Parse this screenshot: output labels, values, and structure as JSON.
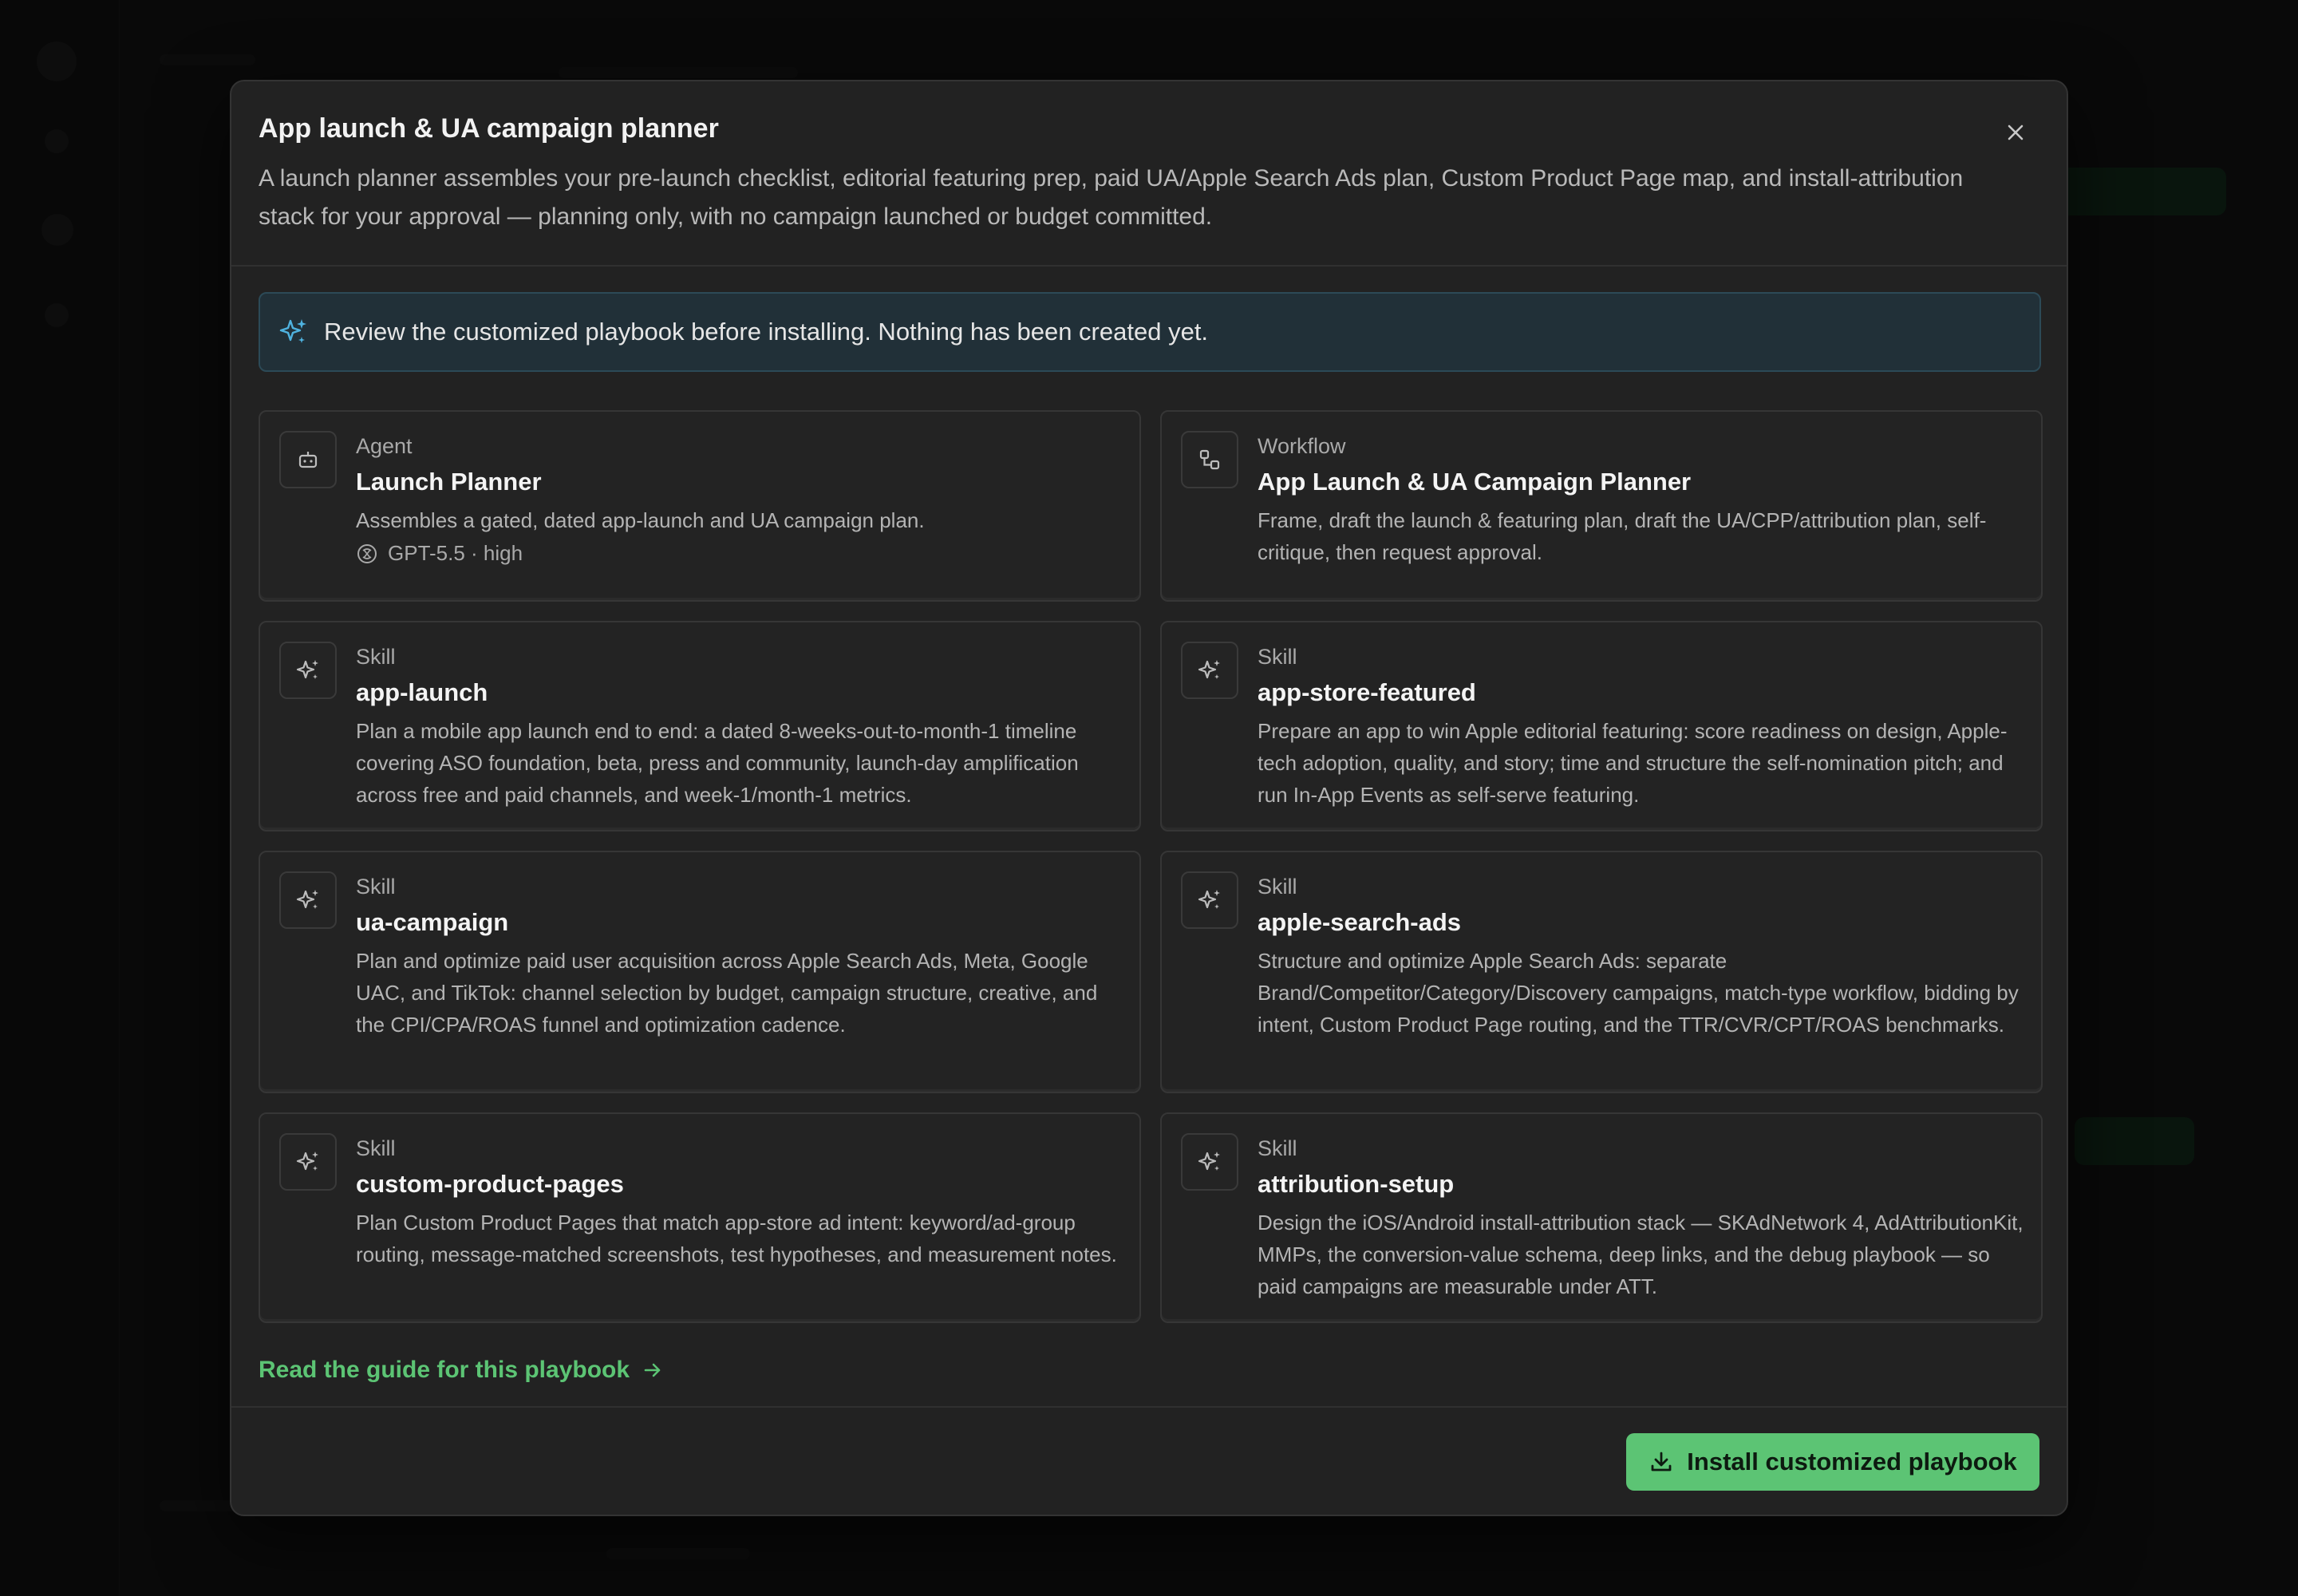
{
  "modal": {
    "title": "App launch & UA campaign planner",
    "description": "A launch planner assembles your pre-launch checklist, editorial featuring prep, paid UA/Apple Search Ads plan, Custom Product Page map, and install-attribution stack for your approval — planning only, with no campaign launched or budget committed."
  },
  "notice": {
    "text": "Review the customized playbook before installing. Nothing has been created yet."
  },
  "cards": [
    {
      "type": "Agent",
      "name": "Launch Planner",
      "description": "Assembles a gated, dated app-launch and UA campaign plan.",
      "model": "GPT-5.5 · high",
      "icon": "robot-icon"
    },
    {
      "type": "Workflow",
      "name": "App Launch & UA Campaign Planner",
      "description": "Frame, draft the launch & featuring plan, draft the UA/CPP/attribution plan, self-critique, then request approval.",
      "icon": "workflow-icon"
    },
    {
      "type": "Skill",
      "name": "app-launch",
      "description": "Plan a mobile app launch end to end: a dated 8-weeks-out-to-month-1 timeline covering ASO foundation, beta, press and community, launch-day amplification across free and paid channels, and week-1/month-1 metrics.",
      "icon": "sparkle-icon"
    },
    {
      "type": "Skill",
      "name": "app-store-featured",
      "description": "Prepare an app to win Apple editorial featuring: score readiness on design, Apple-tech adoption, quality, and story; time and structure the self-nomination pitch; and run In-App Events as self-serve featuring.",
      "icon": "sparkle-icon"
    },
    {
      "type": "Skill",
      "name": "ua-campaign",
      "description": "Plan and optimize paid user acquisition across Apple Search Ads, Meta, Google UAC, and TikTok: channel selection by budget, campaign structure, creative, and the CPI/CPA/ROAS funnel and optimization cadence.",
      "icon": "sparkle-icon"
    },
    {
      "type": "Skill",
      "name": "apple-search-ads",
      "description": "Structure and optimize Apple Search Ads: separate Brand/Competitor/Category/Discovery campaigns, match-type workflow, bidding by intent, Custom Product Page routing, and the TTR/CVR/CPT/ROAS benchmarks.",
      "icon": "sparkle-icon"
    },
    {
      "type": "Skill",
      "name": "custom-product-pages",
      "description": "Plan Custom Product Pages that match app-store ad intent: keyword/ad-group routing, message-matched screenshots, test hypotheses, and measurement notes.",
      "icon": "sparkle-icon"
    },
    {
      "type": "Skill",
      "name": "attribution-setup",
      "description": "Design the iOS/Android install-attribution stack — SKAdNetwork 4, AdAttributionKit, MMPs, the conversion-value schema, deep links, and the debug playbook — so paid campaigns are measurable under ATT.",
      "icon": "sparkle-icon"
    }
  ],
  "guide_link": "Read the guide for this playbook",
  "install_button": "Install customized playbook",
  "colors": {
    "accent": "#5cc474",
    "notice_icon": "#4fb3e0"
  }
}
